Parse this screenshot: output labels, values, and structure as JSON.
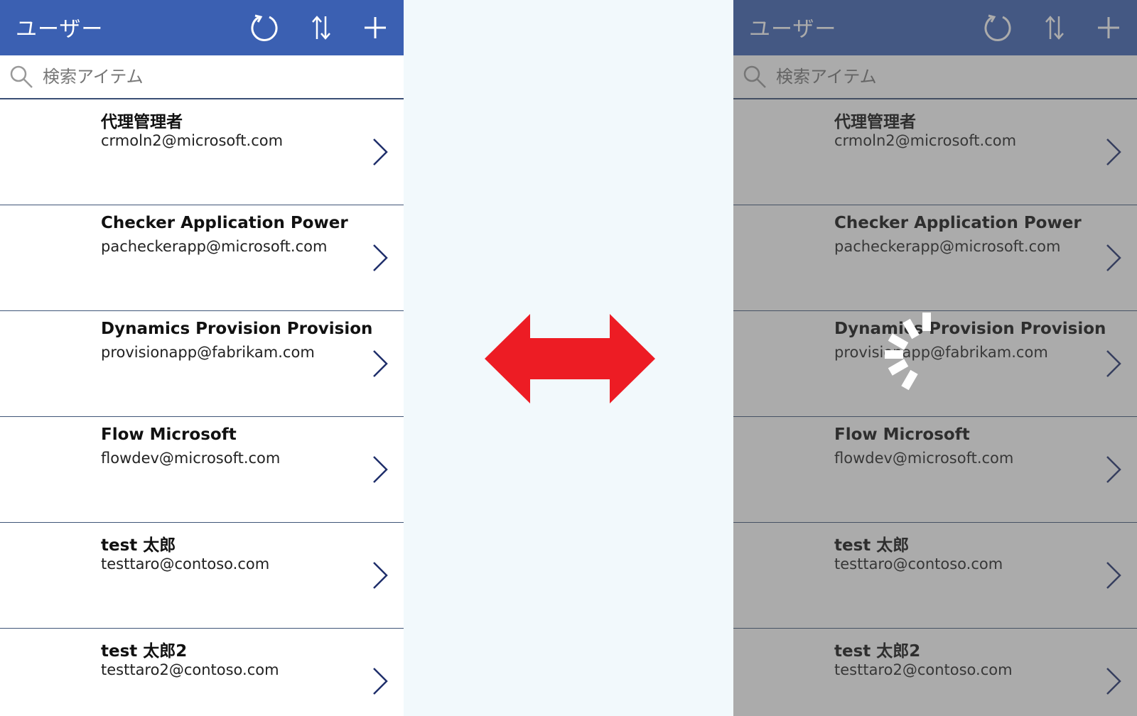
{
  "app": {
    "title": "ユーザー",
    "search_placeholder": "検索アイテム"
  },
  "users": [
    {
      "name": "代理管理者",
      "email": "crmoln2@microsoft.com"
    },
    {
      "name": "Checker Application Power",
      "email": "pacheckerapp@microsoft.com"
    },
    {
      "name": "Dynamics Provision Provision",
      "email": "provisionapp@fabrikam.com"
    },
    {
      "name": "Flow Microsoft",
      "email": "flowdev@microsoft.com"
    },
    {
      "name": "test 太郎",
      "email": "testtaro@contoso.com"
    },
    {
      "name": "test 太郎2",
      "email": "testtaro2@contoso.com"
    }
  ],
  "colors": {
    "header": "#3b60b2",
    "divider": "#3f5578",
    "arrow": "#ed1c24",
    "background": "#f2f9fc",
    "chevron": "#1f2f6b"
  },
  "icons": [
    "reload-icon",
    "sort-icon",
    "add-icon",
    "search-icon",
    "chevron-right-icon",
    "double-arrow-icon",
    "loading-spinner-icon"
  ]
}
